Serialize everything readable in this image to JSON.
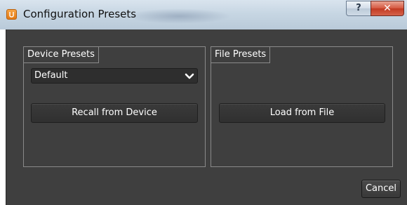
{
  "window": {
    "title": "Configuration Presets",
    "app_icon": "app-logo-icon",
    "help_label": "?",
    "close_label": "✕"
  },
  "device_presets": {
    "title": "Device Presets",
    "selected_preset": "Default",
    "recall_label": "Recall from Device"
  },
  "file_presets": {
    "title": "File Presets",
    "load_label": "Load from File"
  },
  "footer": {
    "cancel_label": "Cancel"
  },
  "colors": {
    "client_background": "#3f3f3f",
    "close_button": "#c23a22",
    "app_icon": "#f08a1c"
  }
}
